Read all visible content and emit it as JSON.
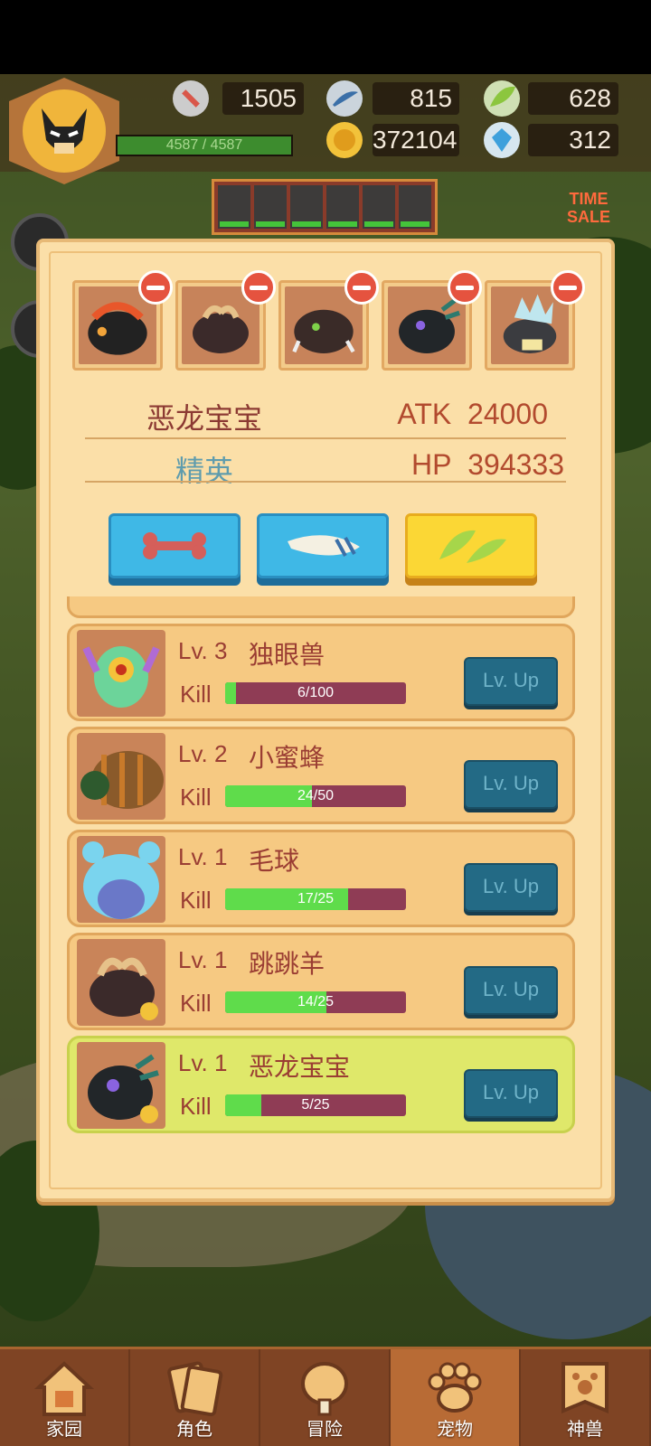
{
  "hud": {
    "hp_text": "4587 / 4587",
    "hp_fraction": 1.0,
    "resources": [
      {
        "icon": "bone-icon",
        "value": "1505"
      },
      {
        "icon": "claw-icon",
        "value": "815"
      },
      {
        "icon": "wing-icon",
        "value": "628"
      },
      {
        "icon": "gold-coin-icon",
        "value": "372104"
      },
      {
        "icon": "gem-icon",
        "value": "312"
      }
    ],
    "sale_text": "TIME SALE"
  },
  "panel": {
    "name": "恶龙宝宝",
    "rank": "精英",
    "atk_label": "ATK",
    "atk_value": "24000",
    "hp_label": "HP",
    "hp_value": "394333",
    "food_buttons": [
      "bone-icon",
      "claw-icon",
      "wing-icon"
    ],
    "selected_food": "wing-icon"
  },
  "pets": [
    {
      "level_label": "Lv. 3",
      "name": "独眼兽",
      "kill_label": "Kill",
      "progress": "6/100",
      "fraction": 0.06,
      "button": "Lv. Up",
      "active": false
    },
    {
      "level_label": "Lv. 2",
      "name": "小蜜蜂",
      "kill_label": "Kill",
      "progress": "24/50",
      "fraction": 0.48,
      "button": "Lv. Up",
      "active": false
    },
    {
      "level_label": "Lv. 1",
      "name": "毛球",
      "kill_label": "Kill",
      "progress": "17/25",
      "fraction": 0.68,
      "button": "Lv. Up",
      "active": false
    },
    {
      "level_label": "Lv. 1",
      "name": "跳跳羊",
      "kill_label": "Kill",
      "progress": "14/25",
      "fraction": 0.56,
      "button": "Lv. Up",
      "active": false
    },
    {
      "level_label": "Lv. 1",
      "name": "恶龙宝宝",
      "kill_label": "Kill",
      "progress": "5/25",
      "fraction": 0.2,
      "button": "Lv. Up",
      "active": true
    }
  ],
  "nav": [
    {
      "label": "家园",
      "icon": "home-icon",
      "selected": false
    },
    {
      "label": "角色",
      "icon": "cards-icon",
      "selected": false
    },
    {
      "label": "冒险",
      "icon": "drumstick-icon",
      "selected": false
    },
    {
      "label": "宠物",
      "icon": "paw-icon",
      "selected": true
    },
    {
      "label": "神兽",
      "icon": "banner-paw-icon",
      "selected": false
    }
  ],
  "colors": {
    "accent_green": "#5fdc4b",
    "panel_bg": "#fbdfa8",
    "text_red": "#9a3d33"
  }
}
